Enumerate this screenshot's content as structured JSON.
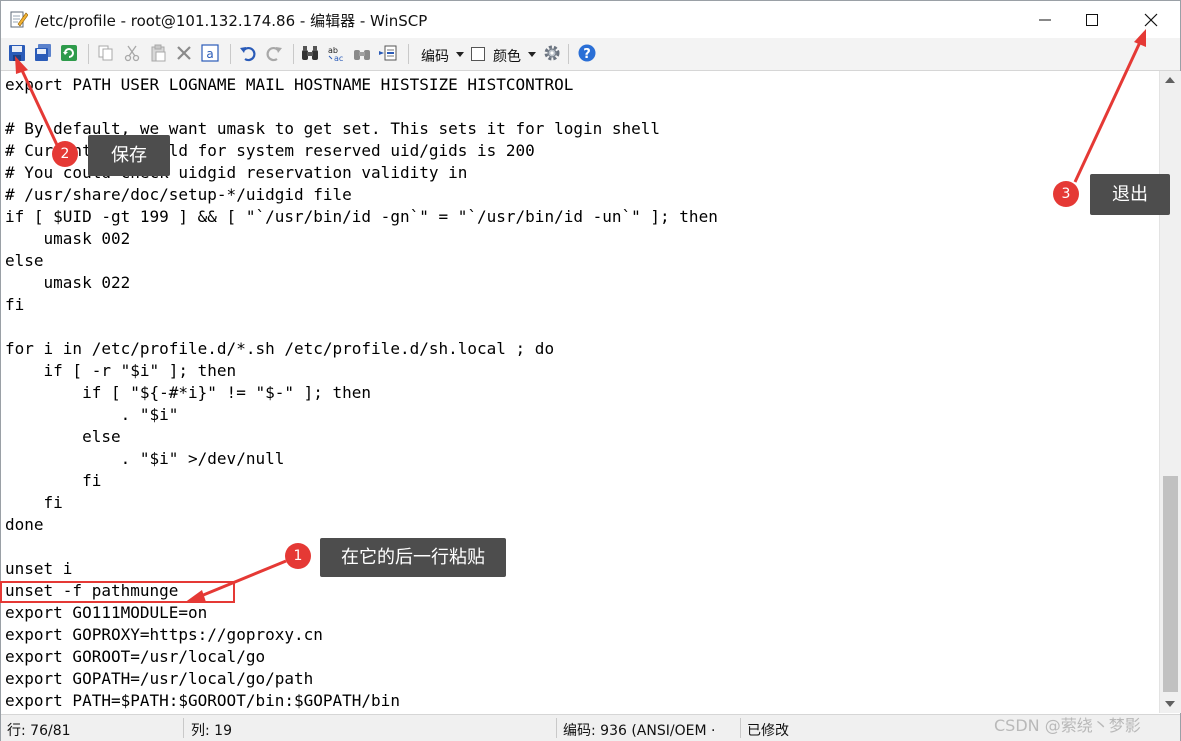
{
  "window": {
    "title": "/etc/profile - root@101.132.174.86 - 编辑器 - WinSCP"
  },
  "toolbar": {
    "encoding_label": "编码",
    "color_label": "颜色"
  },
  "editor": {
    "lines": [
      "export PATH USER LOGNAME MAIL HOSTNAME HISTSIZE HISTCONTROL",
      "",
      "# By default, we want umask to get set. This sets it for login shell",
      "# Current threshold for system reserved uid/gids is 200",
      "# You could check uidgid reservation validity in",
      "# /usr/share/doc/setup-*/uidgid file",
      "if [ $UID -gt 199 ] && [ \"`/usr/bin/id -gn`\" = \"`/usr/bin/id -un`\" ]; then",
      "    umask 002",
      "else",
      "    umask 022",
      "fi",
      "",
      "for i in /etc/profile.d/*.sh /etc/profile.d/sh.local ; do",
      "    if [ -r \"$i\" ]; then",
      "        if [ \"${-#*i}\" != \"$-\" ]; then",
      "            . \"$i\"",
      "        else",
      "            . \"$i\" >/dev/null",
      "        fi",
      "    fi",
      "done",
      "",
      "unset i",
      "unset -f pathmunge",
      "export GO111MODULE=on",
      "export GOPROXY=https://goproxy.cn",
      "export GOROOT=/usr/local/go",
      "export GOPATH=/usr/local/go/path",
      "export PATH=$PATH:$GOROOT/bin:$GOPATH/bin"
    ]
  },
  "status": {
    "line": "行: 76/81",
    "column": "列: 19",
    "encoding": "编码: 936  (ANSI/OEM ·",
    "modified": "已修改"
  },
  "annotations": {
    "callout_1": {
      "number": "1",
      "text": "在它的后一行粘贴"
    },
    "callout_2": {
      "number": "2",
      "text": "保存"
    },
    "callout_3": {
      "number": "3",
      "text": "退出"
    }
  },
  "watermark": "CSDN @萦绕丶梦影",
  "colors": {
    "annotation_red": "#e53935",
    "callout_bg": "#4d4d4d",
    "toolbar_bg": "#f3f3f3"
  }
}
